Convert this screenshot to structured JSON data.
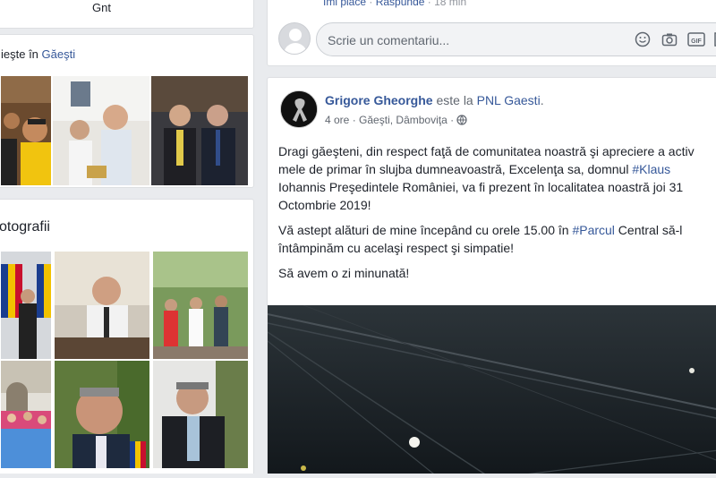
{
  "left": {
    "top_card": {
      "text": "Gnt"
    },
    "live_card": {
      "prefix": "ieşte în ",
      "location": "Găeşti"
    },
    "photos_card": {
      "title": "otografii"
    }
  },
  "comment_area": {
    "reply_meta": {
      "like": "Îmi place",
      "separator": "·",
      "reply": "Răspunde",
      "time": "18 min"
    },
    "input": {
      "placeholder": "Scrie un comentariu..."
    },
    "icons": [
      "smiley-icon",
      "camera-icon",
      "gif-icon",
      "sticker-icon"
    ]
  },
  "post": {
    "author": "Grigore Gheorghe",
    "at_text": " este la ",
    "page": "PNL Gaesti",
    "page_suffix": ".",
    "time": "4 ore",
    "location": "Găeşti, Dâmboviţa",
    "dot": "·",
    "paragraphs": [
      {
        "before": "Dragi găeşteni, din respect faţă de comunitatea noastră şi apreciere a activ",
        "line2_pre": "mele de primar în slujba dumneavoastră, Excelenţa sa, domnul ",
        "hashtag": "#Klaus",
        "line3": "Iohannis Preşedintele României, va fi prezent în localitatea noastră joi 31",
        "line4": "Octombrie 2019!"
      },
      {
        "pre": "Vă astept alături de mine începând cu orele 15.00 în ",
        "hashtag": "#Parcul",
        "post": " Central să-l",
        "line2": "întâmpinăm cu acelaşi respect şi simpatie!"
      },
      {
        "text": "Să avem o zi minunată!"
      }
    ]
  },
  "colors": {
    "background": "#e9ebee",
    "link": "#365899",
    "text": "#1d2129",
    "muted": "#616770"
  }
}
